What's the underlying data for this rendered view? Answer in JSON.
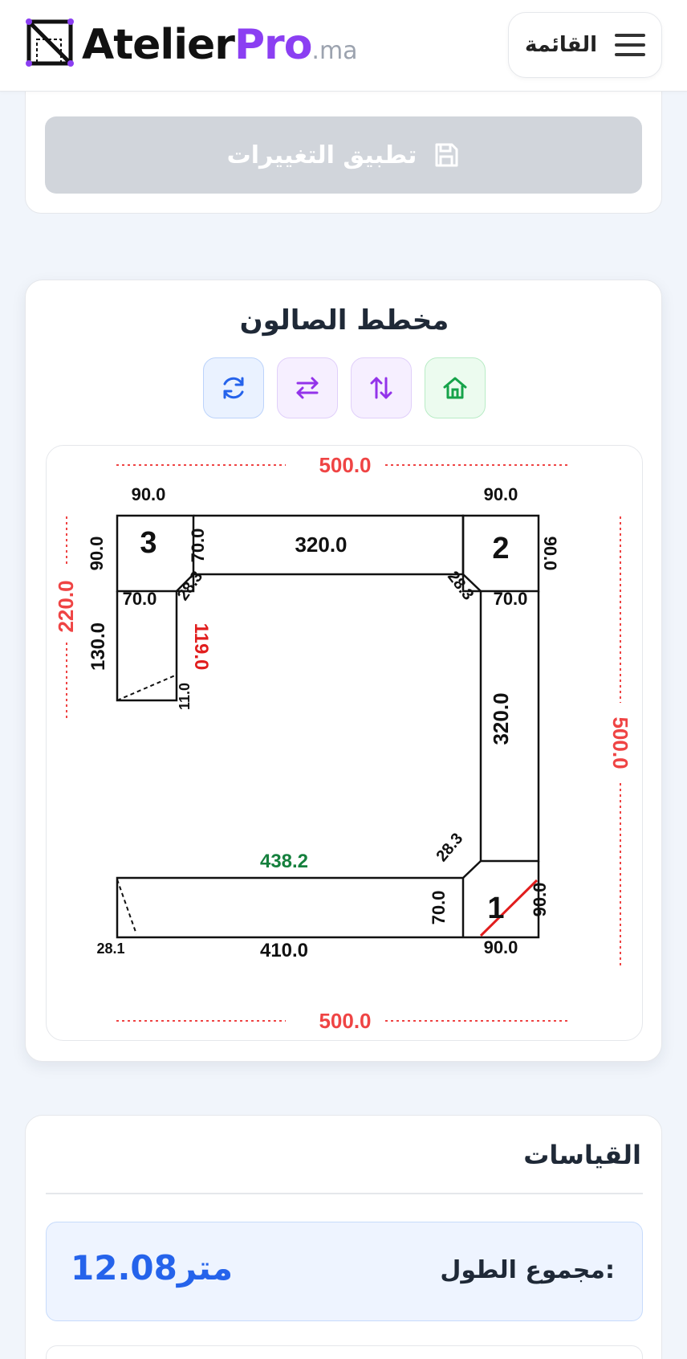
{
  "header": {
    "logo_part1": "Atelier",
    "logo_part2": "Pro",
    "logo_part3": ".ma",
    "menu_label": "القائمة"
  },
  "top_card": {
    "apply_label": "تطبيق التغييرات"
  },
  "plan": {
    "title": "مخطط الصالون",
    "tools": [
      "refresh-icon",
      "swap-horizontal-icon",
      "swap-vertical-icon",
      "home-icon"
    ],
    "overall": {
      "top": "500.0",
      "bottom": "500.0",
      "left": "220.0",
      "right": "500.0"
    },
    "corner3": {
      "number": "3",
      "top": "90.0",
      "left": "90.0",
      "bottom": "70.0",
      "inner": "70.0",
      "diag": "28.3"
    },
    "corner2": {
      "number": "2",
      "top": "90.0",
      "right": "90.0",
      "bottom": "70.0",
      "diag": "28.3"
    },
    "corner1": {
      "number": "1",
      "right": "90.0",
      "bottom": "90.0",
      "diag": "28.3"
    },
    "top_segment": "320.0",
    "right_segment": "320.0",
    "left_segment": {
      "length": "130.0",
      "inner": "119.0",
      "end": "11.0"
    },
    "bottom_segment": {
      "length": "410.0",
      "depth": "70.0",
      "inner": "438.2",
      "end": "28.1"
    },
    "colors": {
      "overall": "#ef4444",
      "inner_red": "#e11d1d",
      "inner_green": "#15803d"
    }
  },
  "measurements": {
    "title": "القياسات",
    "total_label": "مجموع الطول:",
    "total_value": "12.08متر"
  }
}
